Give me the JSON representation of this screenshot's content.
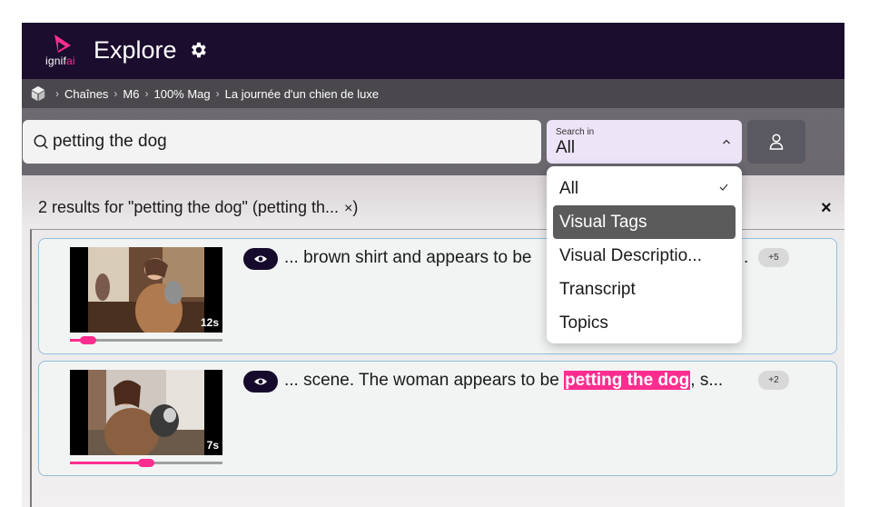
{
  "header": {
    "logo_text": "ignif",
    "logo_text_accent": "ai",
    "title": "Explore",
    "icons": {
      "logo": "ignifai-logo",
      "settings": "gear-icon"
    },
    "colors": {
      "background": "#1a0d2e",
      "accent": "#ff2d8f"
    }
  },
  "breadcrumb": {
    "home_icon": "cube-icon",
    "items": [
      "Chaînes",
      "M6",
      "100% Mag",
      "La journée d'un chien de luxe"
    ]
  },
  "search": {
    "value": "petting the dog",
    "icon": "search-icon"
  },
  "search_in": {
    "label": "Search in",
    "value": "All",
    "open": true
  },
  "user_button": {
    "icon": "user-icon"
  },
  "results": {
    "summary": "2 results for \"petting the dog\" (petting th...",
    "clear_glyph": "×",
    "close_glyph": "×",
    "items": [
      {
        "duration": "12s",
        "progress": 0.12,
        "snippet_before": "... brown shirt and appears to be",
        "highlight": "",
        "snippet_after": "",
        "trailing": ".",
        "more_badge": "+5"
      },
      {
        "duration": "7s",
        "progress": 0.5,
        "snippet_before": "... scene. The woman appears to be ",
        "highlight": "petting the dog",
        "snippet_after": ", s...",
        "trailing": "",
        "more_badge": "+2"
      }
    ]
  },
  "menu": {
    "items": [
      {
        "label": "All",
        "checked": true,
        "hovered": false
      },
      {
        "label": "Visual Tags",
        "checked": false,
        "hovered": true
      },
      {
        "label": "Visual Descriptio...",
        "checked": false,
        "hovered": false
      },
      {
        "label": "Transcript",
        "checked": false,
        "hovered": false
      },
      {
        "label": "Topics",
        "checked": false,
        "hovered": false
      }
    ]
  }
}
